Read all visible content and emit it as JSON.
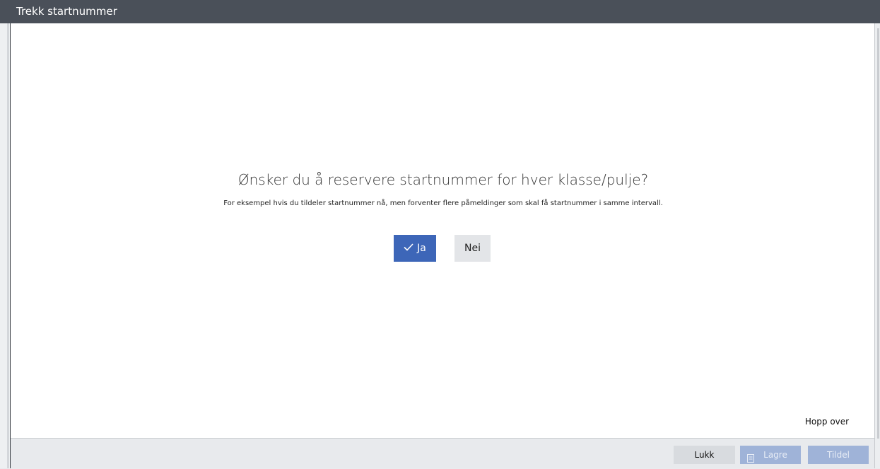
{
  "dialog": {
    "title": "Trekk startnummer",
    "question": "Ønsker du å reservere startnummer for hver klasse/pulje?",
    "description": "For eksempel hvis du tildeler startnummer nå, men forventer flere påmeldinger som skal få startnummer i samme intervall.",
    "yes_label": "Ja",
    "yes_icon": "check-icon",
    "no_label": "Nei",
    "skip_label": "Hopp over",
    "accent_color": "#3d66b8"
  },
  "footer": {
    "close_label": "Lukk",
    "save_label": "Lagre",
    "save_icon": "save-icon",
    "assign_label": "Tildel",
    "save_enabled": false,
    "assign_enabled": false
  }
}
